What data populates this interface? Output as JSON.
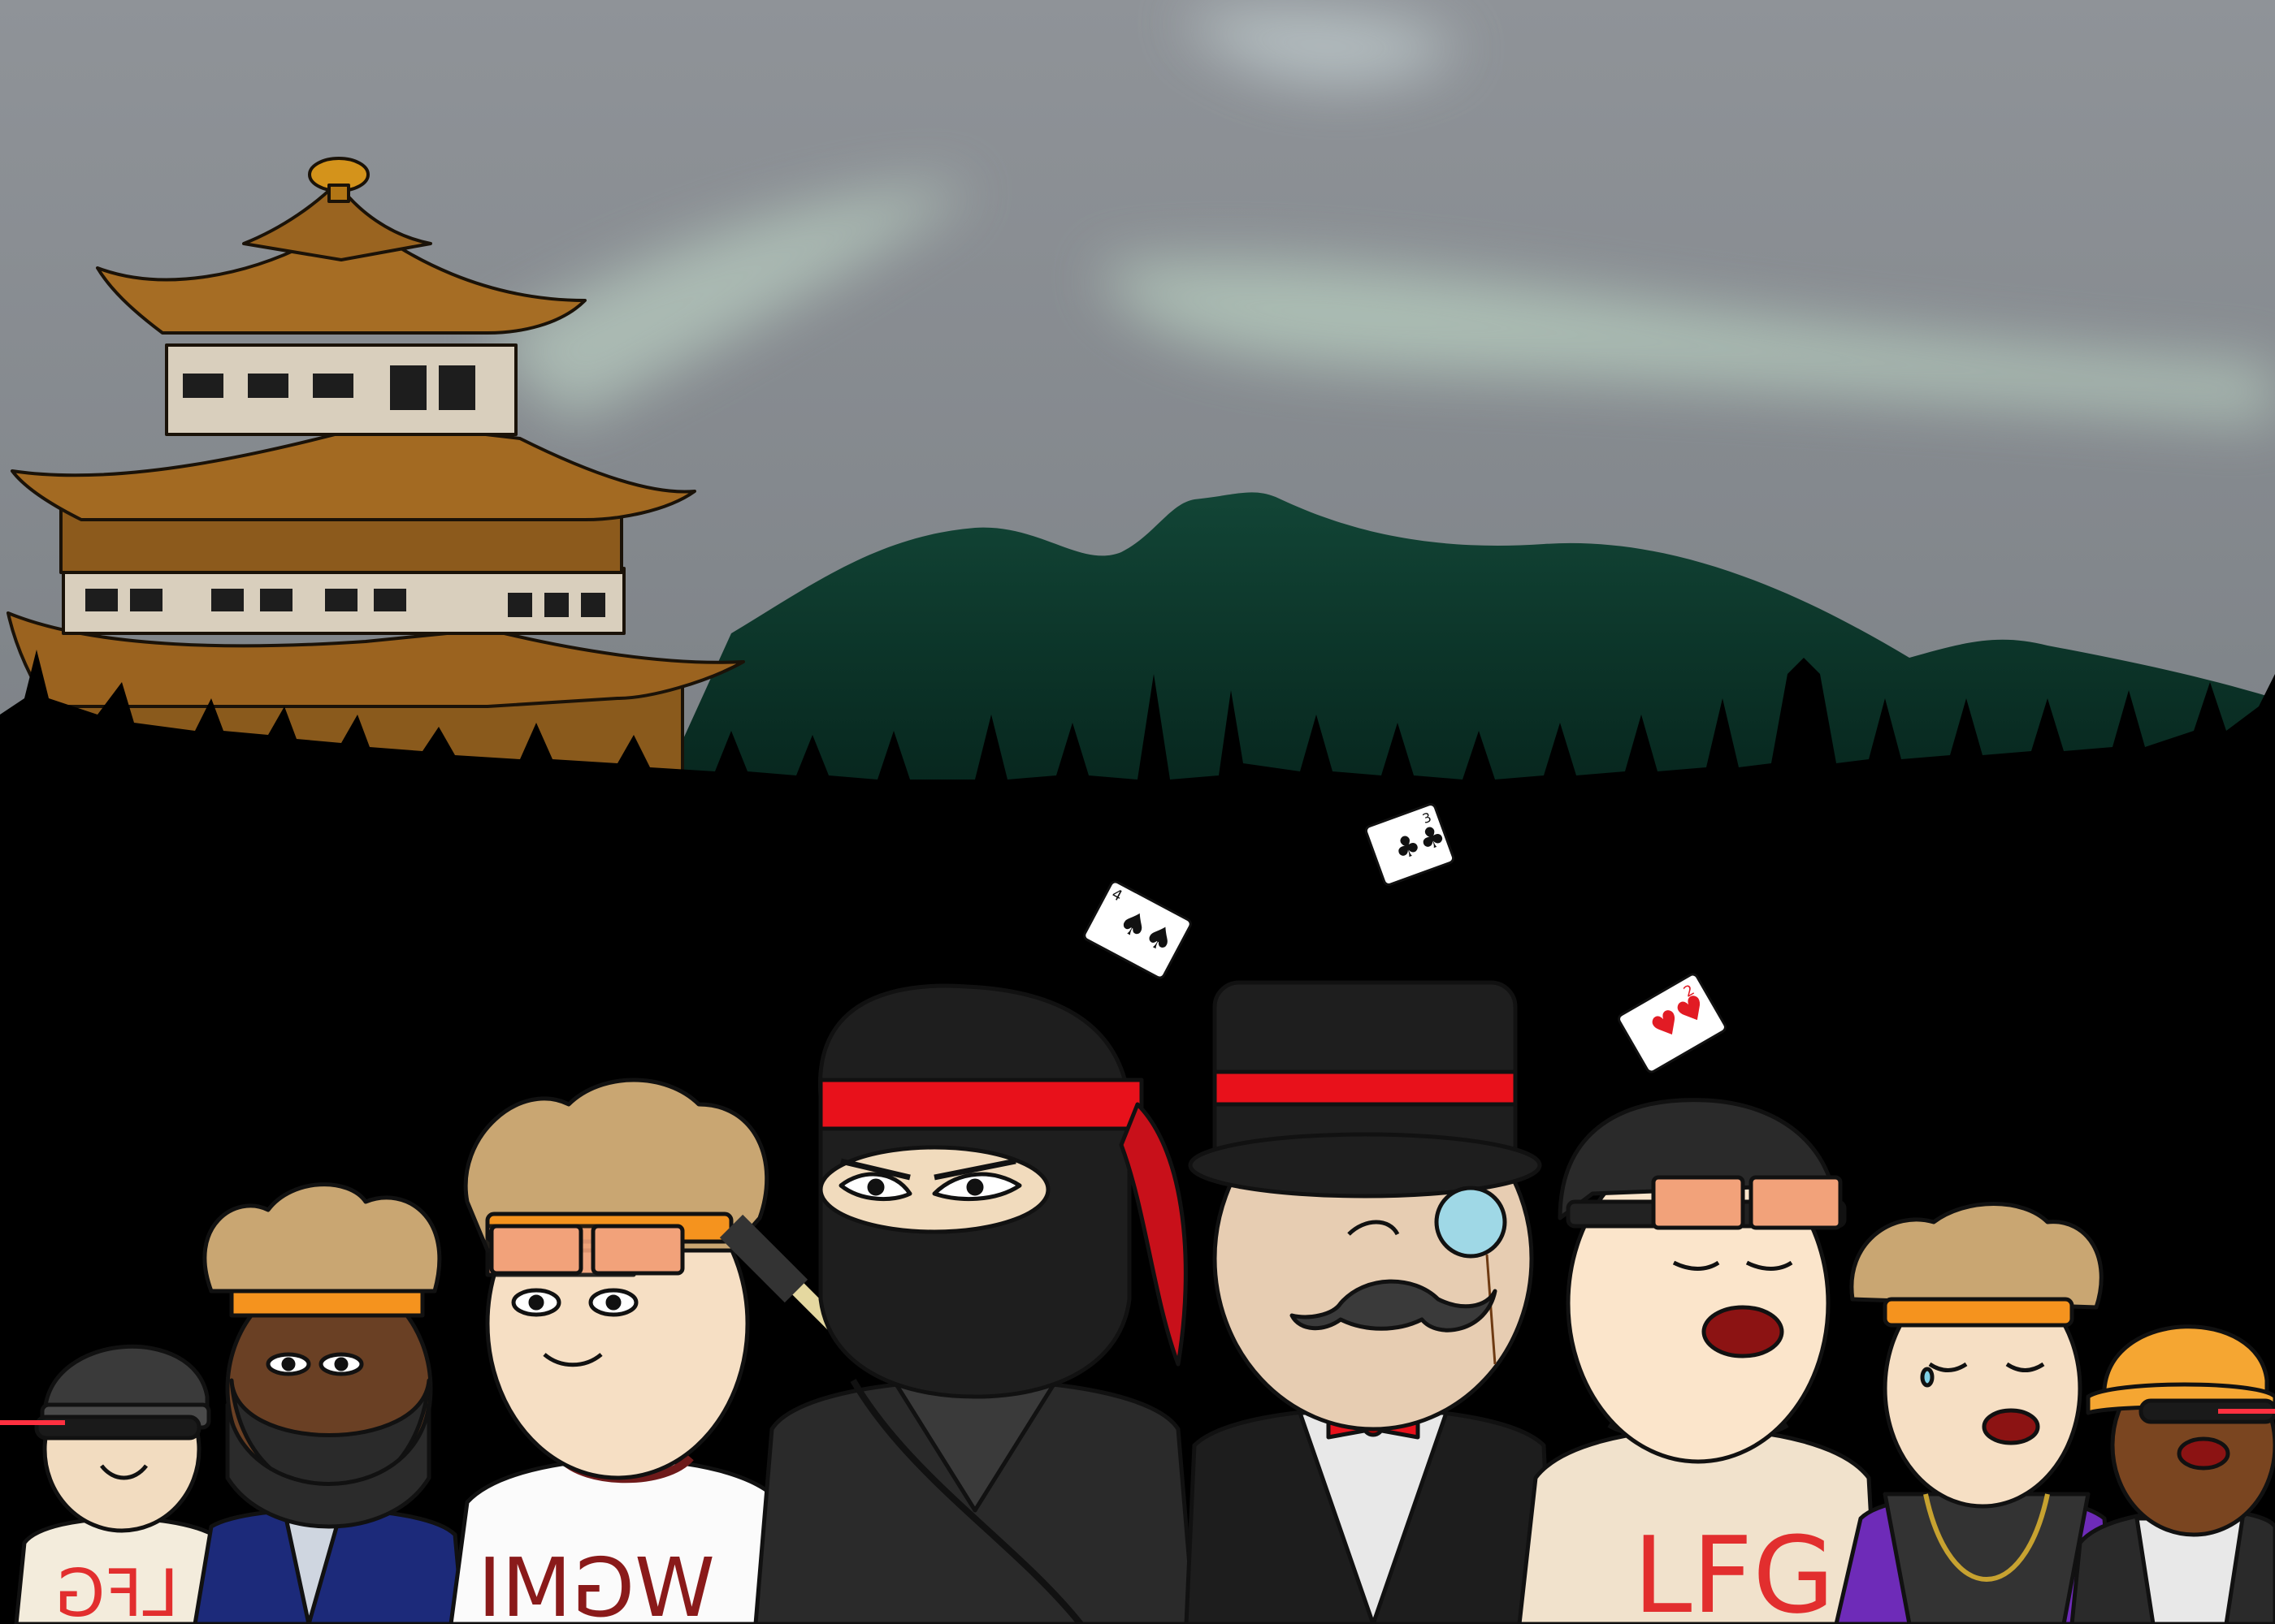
{
  "scene": {
    "colors": {
      "sky": "#8a8e93",
      "aurora": "#b9cfc2",
      "mountain": "#0f3a2e",
      "pagoda": "#8b5a17",
      "forest": "#000000",
      "headband_red": "#e8111b",
      "headband_orange": "#f5931e",
      "skin": "#f6dfc4"
    }
  },
  "shirts": {
    "left": "LFG",
    "middle": "WGMI",
    "right": "LFG"
  },
  "cards": {
    "spade": "4",
    "club": "3",
    "heart": "2"
  }
}
